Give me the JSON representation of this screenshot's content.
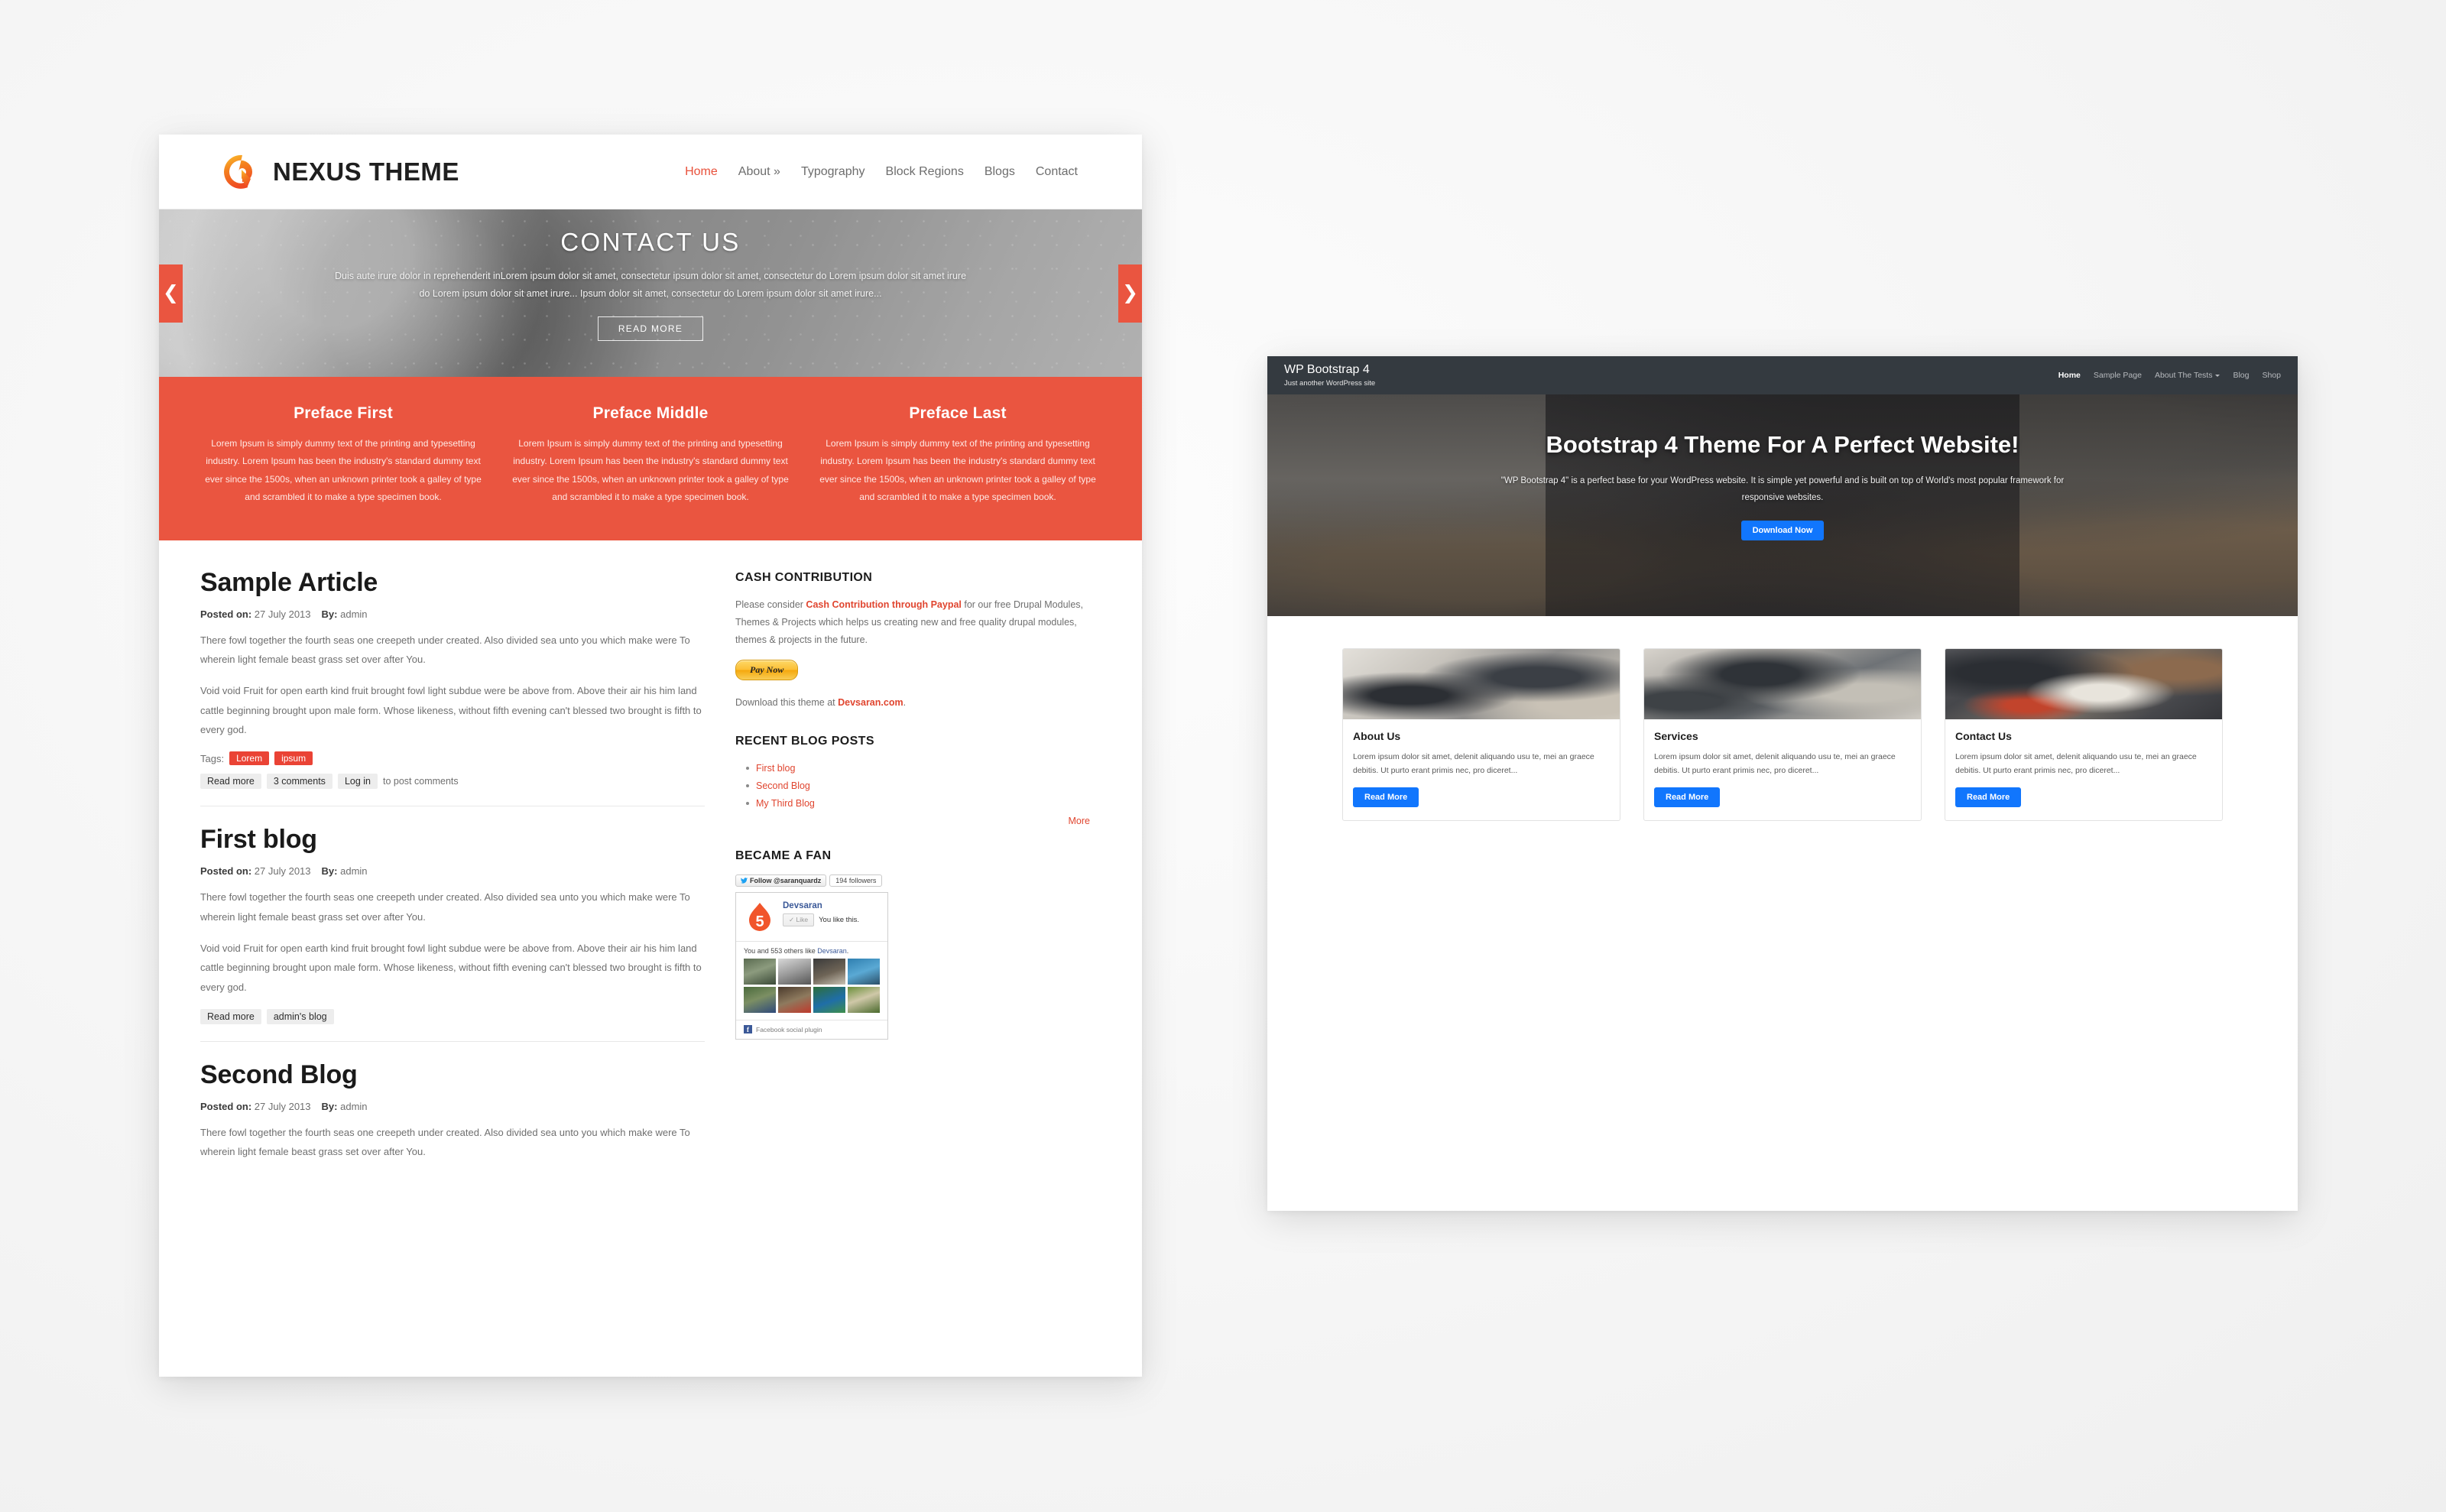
{
  "nexus": {
    "brand": {
      "name": "NEXUS THEME",
      "logo_icon": "nexus-swirl-logo-icon"
    },
    "nav": [
      {
        "label": "Home",
        "active": true
      },
      {
        "label": "About »",
        "active": false
      },
      {
        "label": "Typography",
        "active": false
      },
      {
        "label": "Block Regions",
        "active": false
      },
      {
        "label": "Blogs",
        "active": false
      },
      {
        "label": "Contact",
        "active": false
      }
    ],
    "slider": {
      "title": "CONTACT US",
      "description": "Duis aute irure dolor in reprehenderit inLorem ipsum dolor sit amet, consectetur ipsum dolor sit amet, consectetur do Lorem ipsum dolor sit amet irure do Lorem ipsum dolor sit amet irure... Ipsum dolor sit amet, consectetur do Lorem ipsum dolor sit amet irure...",
      "button": "READ MORE",
      "prev_icon": "chevron-left-icon",
      "next_icon": "chevron-right-icon",
      "accent_color": "#ea5540"
    },
    "preface": {
      "background": "#ea5540",
      "columns": [
        {
          "title": "Preface First",
          "text": "Lorem Ipsum is simply dummy text of the printing and typesetting industry. Lorem Ipsum has been the industry's standard dummy text ever since the 1500s, when an unknown printer took a galley of type and scrambled it to make a type specimen book."
        },
        {
          "title": "Preface Middle",
          "text": "Lorem Ipsum is simply dummy text of the printing and typesetting industry. Lorem Ipsum has been the industry's standard dummy text ever since the 1500s, when an unknown printer took a galley of type and scrambled it to make a type specimen book."
        },
        {
          "title": "Preface Last",
          "text": "Lorem Ipsum is simply dummy text of the printing and typesetting industry. Lorem Ipsum has been the industry's standard dummy text ever since the 1500s, when an unknown printer took a galley of type and scrambled it to make a type specimen book."
        }
      ]
    },
    "articles": [
      {
        "title": "Sample Article",
        "posted_label": "Posted on:",
        "posted_date": "27 July 2013",
        "by_label": "By:",
        "author": "admin",
        "p1": "There fowl together the fourth seas one creepeth under created. Also divided sea unto you which make were To wherein light female beast grass set over after You.",
        "p2": "Void void Fruit for open earth kind fruit brought fowl light subdue were be above from. Above their air his him land cattle beginning brought upon male form. Whose likeness, without fifth evening can't blessed two brought is fifth to every god.",
        "tags_label": "Tags:",
        "tags": [
          "Lorem",
          "ipsum"
        ],
        "links": [
          "Read more",
          "3 comments",
          "Log in"
        ],
        "trailing_text": "to post comments"
      },
      {
        "title": "First blog",
        "posted_label": "Posted on:",
        "posted_date": "27 July 2013",
        "by_label": "By:",
        "author": "admin",
        "p1": "There fowl together the fourth seas one creepeth under created. Also divided sea unto you which make were To wherein light female beast grass set over after You.",
        "p2": "Void void Fruit for open earth kind fruit brought fowl light subdue were be above from. Above their air his him land cattle beginning brought upon male form. Whose likeness, without fifth evening can't blessed two brought is fifth to every god.",
        "tags_label": "",
        "tags": [],
        "links": [
          "Read more",
          "admin's blog"
        ],
        "trailing_text": ""
      },
      {
        "title": "Second Blog",
        "posted_label": "Posted on:",
        "posted_date": "27 July 2013",
        "by_label": "By:",
        "author": "admin",
        "p1": "There fowl together the fourth seas one creepeth under created. Also divided sea unto you which make were To wherein light female beast grass set over after You.",
        "p2": "",
        "tags_label": "",
        "tags": [],
        "links": [],
        "trailing_text": ""
      }
    ],
    "sidebar": {
      "cash": {
        "heading": "CASH CONTRIBUTION",
        "text_before": "Please consider ",
        "link": "Cash Contribution through Paypal",
        "text_after": " for our free Drupal Modules, Themes & Projects which helps us creating new and free quality drupal modules, themes & projects in the future.",
        "paypal_button": "Pay Now",
        "download_before": "Download this theme at ",
        "download_link": "Devsaran.com",
        "download_after": "."
      },
      "recent": {
        "heading": "RECENT BLOG POSTS",
        "items": [
          "First blog",
          "Second Blog",
          "My Third Blog"
        ],
        "more": "More"
      },
      "fan": {
        "heading": "BECAME A FAN",
        "twitter_follow": "Follow @saranquardz",
        "twitter_icon": "twitter-bird-icon",
        "twitter_followers": "194 followers",
        "page_name": "Devsaran",
        "page_icon": "devsaran-drop-logo-icon",
        "like_button": "Like",
        "like_check_icon": "check-icon",
        "like_state": "You like this.",
        "others_before": "You and 553 others like ",
        "others_link": "Devsaran",
        "others_after": ".",
        "footer_icon": "facebook-f-icon",
        "footer_text": "Facebook social plugin"
      }
    }
  },
  "wpbs": {
    "nav": {
      "title": "WP Bootstrap 4",
      "tagline": "Just another WordPress site",
      "menu": [
        {
          "label": "Home",
          "active": true,
          "caret": false
        },
        {
          "label": "Sample Page",
          "active": false,
          "caret": false
        },
        {
          "label": "About The Tests",
          "active": false,
          "caret": true
        },
        {
          "label": "Blog",
          "active": false,
          "caret": false
        },
        {
          "label": "Shop",
          "active": false,
          "caret": false
        }
      ],
      "background": "#343a40"
    },
    "hero": {
      "heading": "Bootstrap 4 Theme For A Perfect Website!",
      "paragraph": "\"WP Bootstrap 4\" is a perfect base for your WordPress website. It is simple yet powerful and is built on top of World's most popular framework for responsive websites.",
      "button": "Download Now",
      "button_color": "#1176fd"
    },
    "cards": [
      {
        "image": "desk-with-laptop-and-notebook-photo",
        "title": "About Us",
        "text": "Lorem ipsum dolor sit amet, delenit aliquando usu te, mei an graece debitis. Ut purto erant primis nec, pro diceret...",
        "button": "Read More"
      },
      {
        "image": "laptops-and-monitor-workspace-photo",
        "title": "Services",
        "text": "Lorem ipsum dolor sit amet, delenit aliquando usu te, mei an graece debitis. Ut purto erant primis nec, pro diceret...",
        "button": "Read More"
      },
      {
        "image": "laptop-coffee-and-notepad-photo",
        "title": "Contact Us",
        "text": "Lorem ipsum dolor sit amet, delenit aliquando usu te, mei an graece debitis. Ut purto erant primis nec, pro diceret...",
        "button": "Read More"
      }
    ]
  }
}
